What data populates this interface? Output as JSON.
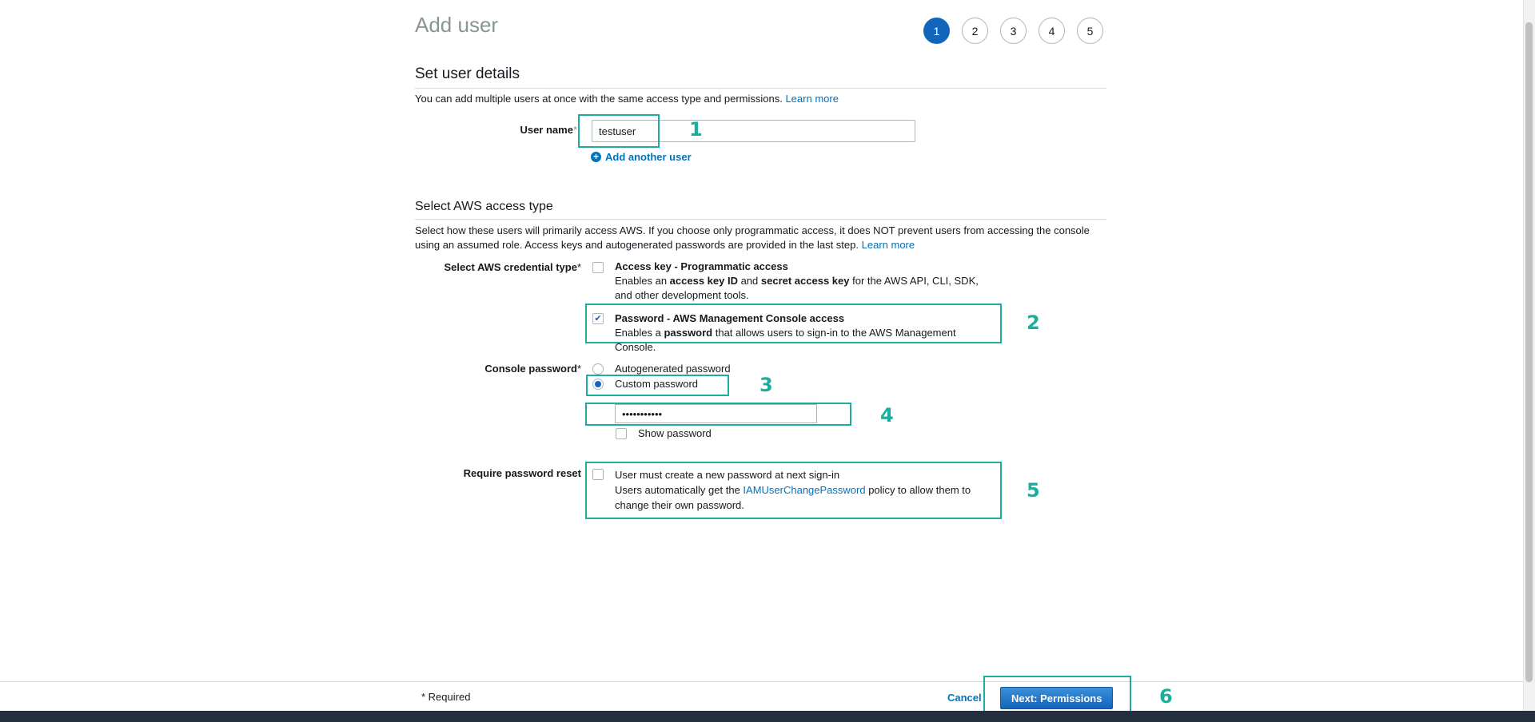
{
  "page": {
    "title": "Add user"
  },
  "stepper": {
    "steps": [
      "1",
      "2",
      "3",
      "4",
      "5"
    ],
    "active": 1
  },
  "user_details": {
    "heading": "Set user details",
    "description": "You can add multiple users at once with the same access type and permissions.",
    "learn_more": "Learn more",
    "user_name_label": "User name",
    "required_mark": "*",
    "user_name_value": "testuser",
    "add_another_user": "Add another user"
  },
  "access_type": {
    "heading": "Select AWS access type",
    "description": "Select how these users will primarily access AWS. If you choose only programmatic access, it does NOT prevent users from accessing the console using an assumed role. Access keys and autogenerated passwords are provided in the last step.",
    "learn_more": "Learn more",
    "credential_label": "Select AWS credential type",
    "access_key": {
      "title": "Access key - Programmatic access",
      "desc_prefix": "Enables an ",
      "bold1": "access key ID",
      "desc_mid": " and ",
      "bold2": "secret access key",
      "desc_suffix": " for the AWS API, CLI, SDK, and other development tools.",
      "checked": false
    },
    "password_access": {
      "title": "Password - AWS Management Console access",
      "desc_prefix": "Enables a ",
      "bold": "password",
      "desc_suffix": " that allows users to sign-in to the AWS Management Console.",
      "checked": true
    }
  },
  "console_password": {
    "label": "Console password",
    "autogenerated": "Autogenerated password",
    "custom": "Custom password",
    "selected": "custom",
    "password_value": "•••••••••••",
    "show_password": "Show password"
  },
  "password_reset": {
    "label": "Require password reset",
    "title": "User must create a new password at next sign-in",
    "desc_prefix": "Users automatically get the ",
    "policy_link": "IAMUserChangePassword",
    "desc_suffix": " policy to allow them to change their own password."
  },
  "footer": {
    "required_note": "* Required",
    "cancel": "Cancel",
    "next": "Next: Permissions"
  },
  "annotations": [
    "1",
    "2",
    "3",
    "4",
    "5",
    "6"
  ],
  "colors": {
    "highlight": "#1aae9f",
    "primary": "#1166bb",
    "link": "#0073bb"
  }
}
